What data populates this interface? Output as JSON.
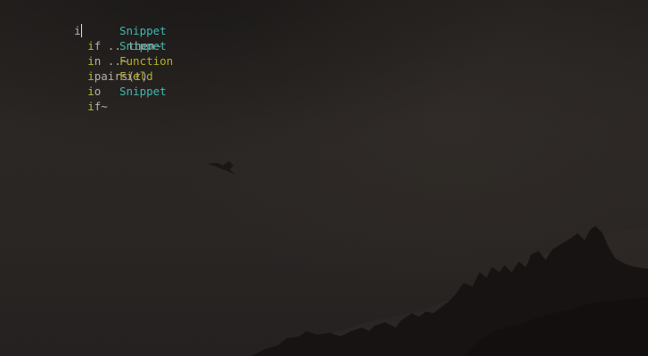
{
  "editor": {
    "typed_text": "i"
  },
  "completion_menu": {
    "items": [
      {
        "match": "i",
        "rest": "f .. then~",
        "kind": "Snippet"
      },
      {
        "match": "i",
        "rest": "n ..~",
        "kind": "Snippet"
      },
      {
        "match": "i",
        "rest": "pairs(t)",
        "kind": "Function"
      },
      {
        "match": "i",
        "rest": "o",
        "kind": "Field"
      },
      {
        "match": "i",
        "rest": "f~",
        "kind": "Snippet"
      }
    ]
  },
  "colors": {
    "background": "#262220",
    "match": "#a6c33a",
    "snippet": "#3fb9ad",
    "function": "#b4b02a",
    "field": "#b4b02a",
    "typed": "#c8a9c0"
  }
}
